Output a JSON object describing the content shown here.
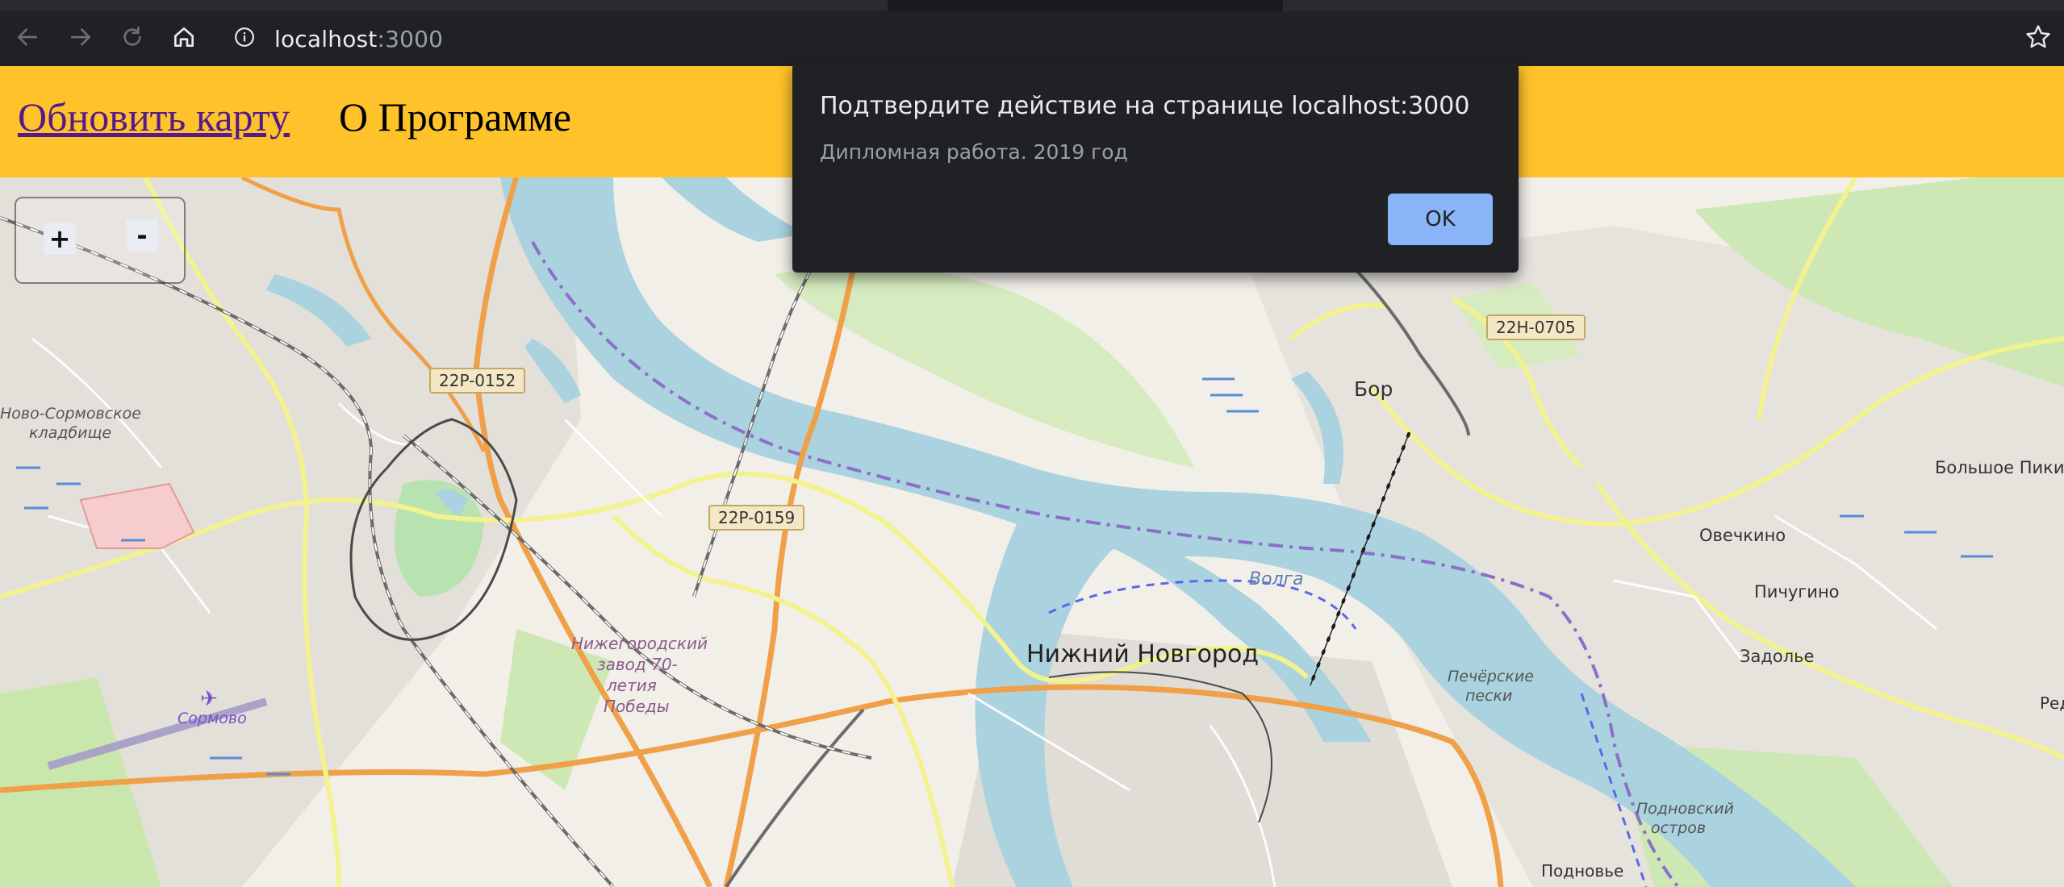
{
  "browser": {
    "url_host": "localhost",
    "url_port": ":3000"
  },
  "header": {
    "refresh_label": "Обновить карту",
    "about_label": "О Программе"
  },
  "map": {
    "zoom_in": "+",
    "zoom_out": "-",
    "road_badges": [
      "22P-0152",
      "22P-0159",
      "22H-0705"
    ],
    "labels": {
      "novo_sormovo": "Ново-Сормовское",
      "novo_sormovo_2": "кладбище",
      "bor": "Бор",
      "bolshoe_piki": "Большое Пики",
      "ovechkino": "Овечкино",
      "pichugino": "Пичугино",
      "volga": "Волга",
      "nizhny": "Нижний Новгород",
      "zavod_1": "Нижегородский",
      "zavod_2": "завод 70-",
      "zavod_3": "летия",
      "zavod_4": "Победы",
      "sormovo": "Сормово",
      "zadolie": "Задолье",
      "pecherskie_1": "Печёрские",
      "pecherskie_2": "пески",
      "podnovsky_1": "Подновский",
      "podnovsky_2": "остров",
      "podnovye": "Подновье",
      "red": "Ред"
    },
    "colors": {
      "river": "#aad3df",
      "major_road": "#f7fabf",
      "trunk_road": "#fcd6a4",
      "rail": "#707070",
      "boundary": "#8b6fc9"
    }
  },
  "dialog": {
    "title": "Подтвердите действие на странице localhost:3000",
    "message": "Дипломная работа. 2019 год",
    "ok_label": "OK"
  }
}
